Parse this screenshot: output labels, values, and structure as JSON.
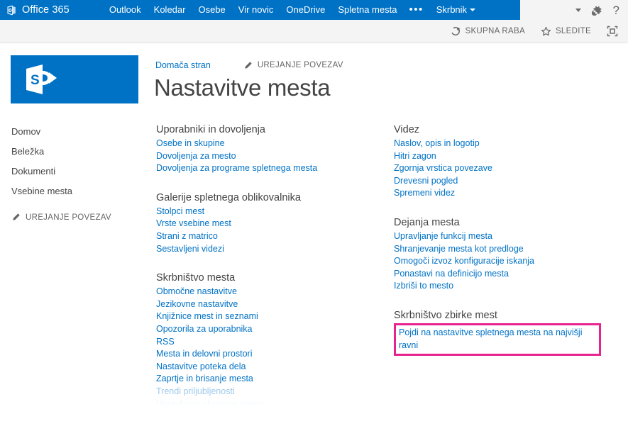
{
  "suite_bar": {
    "brand": "Office 365",
    "brand_icon": "office-tile-icon",
    "nav_items": [
      {
        "label": "Outlook",
        "active": false
      },
      {
        "label": "Koledar",
        "active": false
      },
      {
        "label": "Osebe",
        "active": false
      },
      {
        "label": "Vir novic",
        "active": false
      },
      {
        "label": "OneDrive",
        "active": false
      },
      {
        "label": "Spletna mesta",
        "active": true
      }
    ],
    "overflow_label": "•••",
    "user_label": "Skrbnik",
    "settings_icon": "gear-icon",
    "help_icon": "question-mark-icon",
    "accent_color": "#0072C6"
  },
  "ribbon": {
    "share_label": "SKUPNA RABA",
    "share_icon": "share-icon",
    "follow_label": "SLEDITE",
    "follow_icon": "star-icon",
    "focus_label": "",
    "focus_icon": "focus-on-content-icon"
  },
  "sidebar": {
    "logo_icon": "sharepoint-logo-icon",
    "items": [
      {
        "label": "Domov"
      },
      {
        "label": "Beležka"
      },
      {
        "label": "Dokumenti"
      },
      {
        "label": "Vsebine mesta"
      }
    ],
    "edit_links_label": "UREJANJE POVEZAV",
    "edit_links_icon": "pencil-icon"
  },
  "content": {
    "breadcrumb_home": "Domača stran",
    "edit_links_label": "UREJANJE POVEZAV",
    "edit_links_icon": "pencil-icon",
    "page_title": "Nastavitve mesta"
  },
  "left_column": [
    {
      "heading": "Uporabniki in dovoljenja",
      "links": [
        {
          "label": "Osebe in skupine",
          "state": "normal"
        },
        {
          "label": "Dovoljenja za mesto",
          "state": "normal"
        },
        {
          "label": "Dovoljenja za programe spletnega mesta",
          "state": "normal"
        }
      ]
    },
    {
      "heading": "Galerije spletnega oblikovalnika",
      "links": [
        {
          "label": "Stolpci mest",
          "state": "normal"
        },
        {
          "label": "Vrste vsebine mest",
          "state": "normal"
        },
        {
          "label": "Strani z matrico",
          "state": "normal"
        },
        {
          "label": "Sestavljeni videzi",
          "state": "normal"
        }
      ]
    },
    {
      "heading": "Skrbništvo mesta",
      "links": [
        {
          "label": "Območne nastavitve",
          "state": "normal"
        },
        {
          "label": "Jezikovne nastavitve",
          "state": "normal"
        },
        {
          "label": "Knjižnice mest in seznami",
          "state": "normal"
        },
        {
          "label": "Opozorila za uporabnika",
          "state": "normal"
        },
        {
          "label": "RSS",
          "state": "normal"
        },
        {
          "label": "Mesta in delovni prostori",
          "state": "normal"
        },
        {
          "label": "Nastavitve poteka dela",
          "state": "normal"
        },
        {
          "label": "Zaprtje in brisanje mesta",
          "state": "normal"
        },
        {
          "label": "Trendi priljubljenosti",
          "state": "faded1"
        },
        {
          "label": "Upravljanje shrambe mesta",
          "state": "faded2"
        }
      ]
    }
  ],
  "right_column": [
    {
      "heading": "Videz",
      "links": [
        {
          "label": "Naslov, opis in logotip",
          "state": "normal"
        },
        {
          "label": "Hitri zagon",
          "state": "normal"
        },
        {
          "label": "Zgornja vrstica povezave",
          "state": "normal"
        },
        {
          "label": "Drevesni pogled",
          "state": "normal"
        },
        {
          "label": "Spremeni videz",
          "state": "normal"
        }
      ]
    },
    {
      "heading": "Dejanja mesta",
      "links": [
        {
          "label": "Upravljanje funkcij mesta",
          "state": "normal"
        },
        {
          "label": "Shranjevanje mesta kot predloge",
          "state": "normal"
        },
        {
          "label": "Omogoči izvoz konfiguracije iskanja",
          "state": "normal"
        },
        {
          "label": "Ponastavi na definicijo mesta",
          "state": "normal"
        },
        {
          "label": "Izbriši to mesto",
          "state": "normal"
        }
      ]
    },
    {
      "heading": "Skrbništvo zbirke mest",
      "highlighted": true,
      "highlight_color": "#E8238F",
      "links": [
        {
          "label": "Pojdi na nastavitve spletnega mesta na najvišji ravni",
          "state": "normal"
        }
      ]
    }
  ]
}
